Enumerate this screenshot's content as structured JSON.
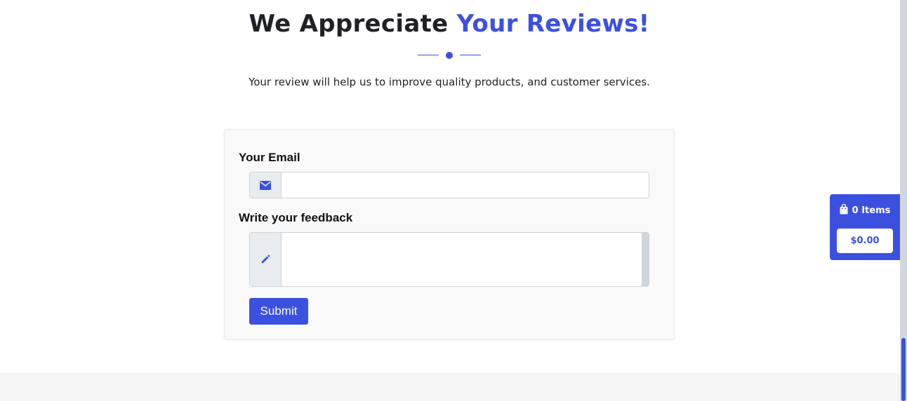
{
  "section": {
    "heading_part1": "We Appreciate ",
    "heading_part2": "Your Reviews!",
    "subtitle": "Your review will help us to improve quality products, and customer services."
  },
  "form": {
    "email_label": "Your Email",
    "email_value": "",
    "email_icon": "envelope-icon",
    "feedback_label": "Write your feedback",
    "feedback_value": "",
    "feedback_icon": "pencil-icon",
    "submit_label": "Submit"
  },
  "cart": {
    "icon": "shopping-bag-icon",
    "items_label": "0 Items",
    "total": "$0.00"
  },
  "colors": {
    "accent": "#3c50e0",
    "addon_bg": "#e9ecef",
    "card_bg": "#f9f9f9"
  }
}
